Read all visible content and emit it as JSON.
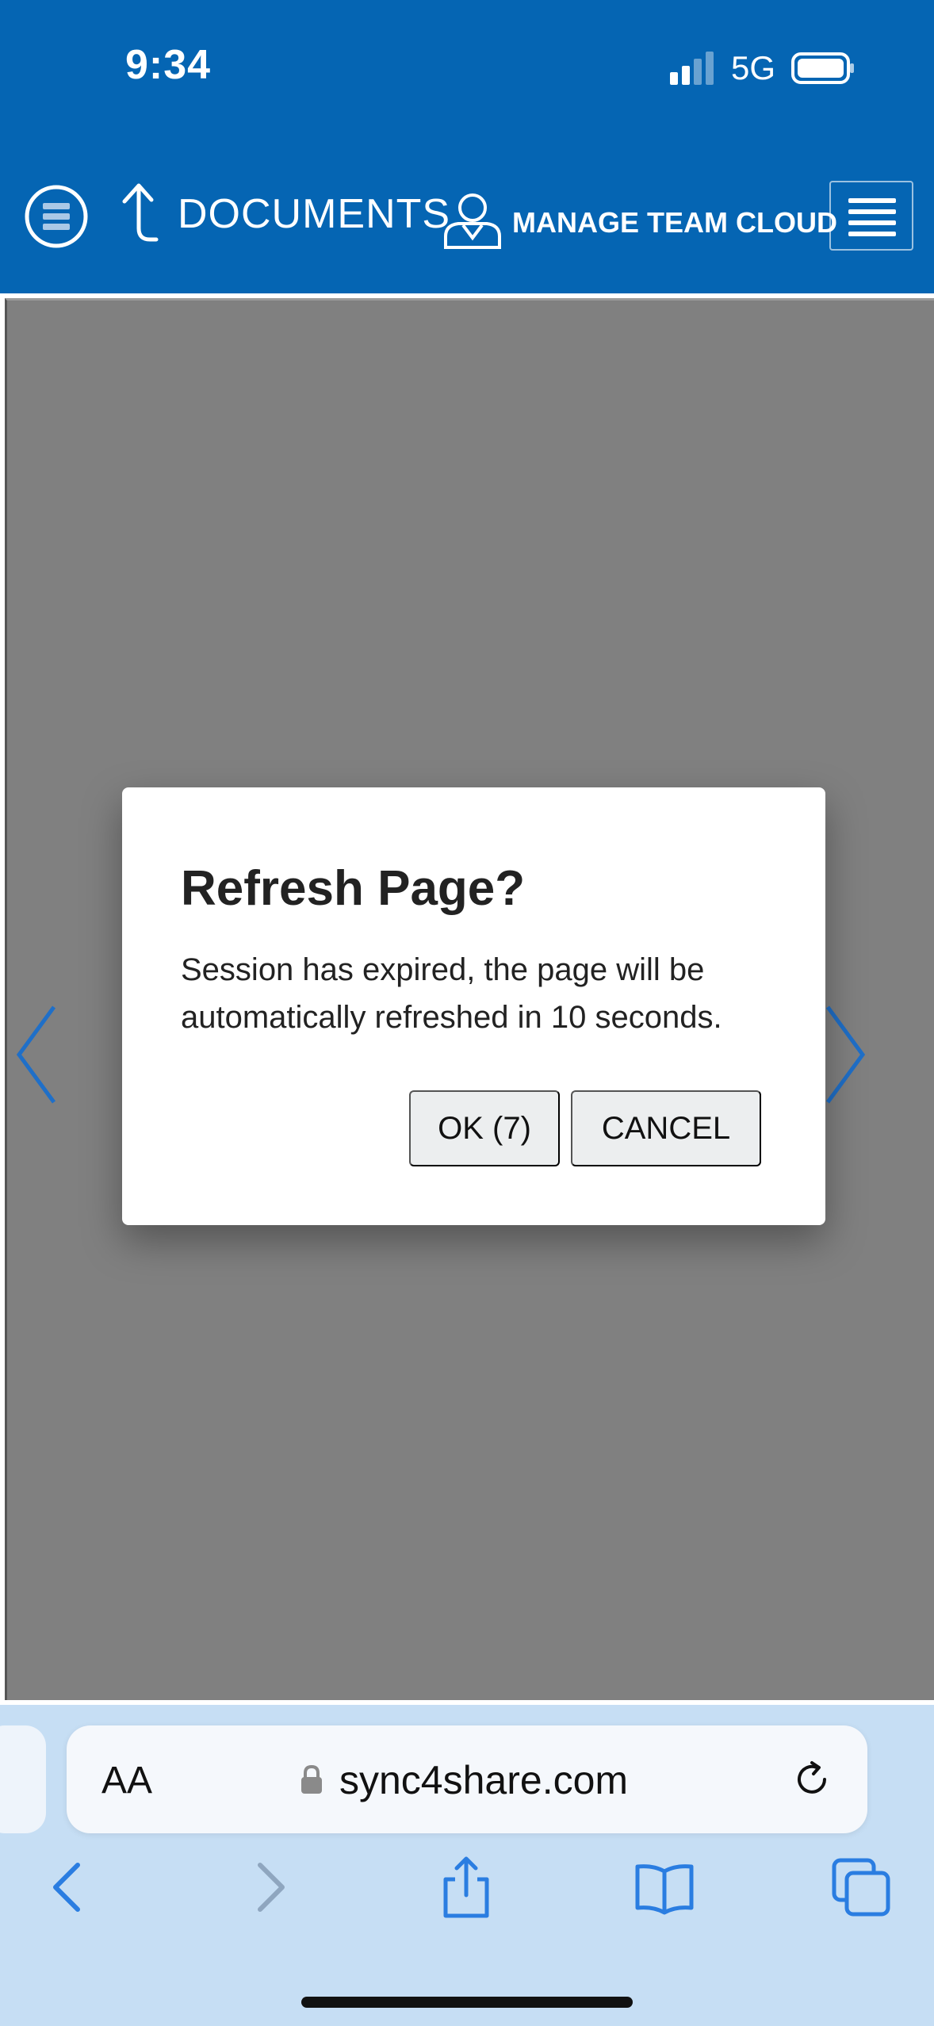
{
  "status": {
    "time": "9:34",
    "network": "5G"
  },
  "toolbar": {
    "documents_label": "DOCUMENTS",
    "team_label": "MANAGE TEAM CLOUD"
  },
  "dialog": {
    "title": "Refresh Page?",
    "message": "Session has expired, the page will be automatically refreshed in 10 seconds.",
    "ok_label": "OK (7)",
    "cancel_label": "CANCEL"
  },
  "browser": {
    "text_size_label": "AA",
    "url": "sync4share.com"
  },
  "colors": {
    "brand_blue": "#0565b3",
    "overlay_gray": "#808080",
    "safari_bar": "#c6def4",
    "ios_blue": "#2a7de1"
  },
  "icons": [
    "signal-icon",
    "battery-icon",
    "menu-circle-icon",
    "up-arrow-icon",
    "person-icon",
    "hamburger-icon",
    "chevron-left-icon",
    "chevron-right-icon",
    "lock-icon",
    "reload-icon",
    "back-icon",
    "forward-icon",
    "share-icon",
    "bookmarks-icon",
    "tabs-icon"
  ]
}
